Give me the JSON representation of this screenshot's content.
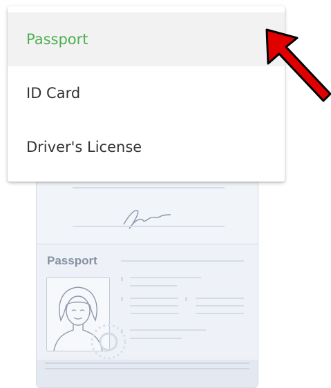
{
  "dropdown": {
    "options": [
      {
        "label": "Passport",
        "selected": true
      },
      {
        "label": "ID Card",
        "selected": false
      },
      {
        "label": "Driver's License",
        "selected": false
      }
    ],
    "selected_color": "#4caf50"
  },
  "illustration": {
    "passport_label": "Passport"
  },
  "annotation": {
    "arrow_color": "#e00000"
  }
}
